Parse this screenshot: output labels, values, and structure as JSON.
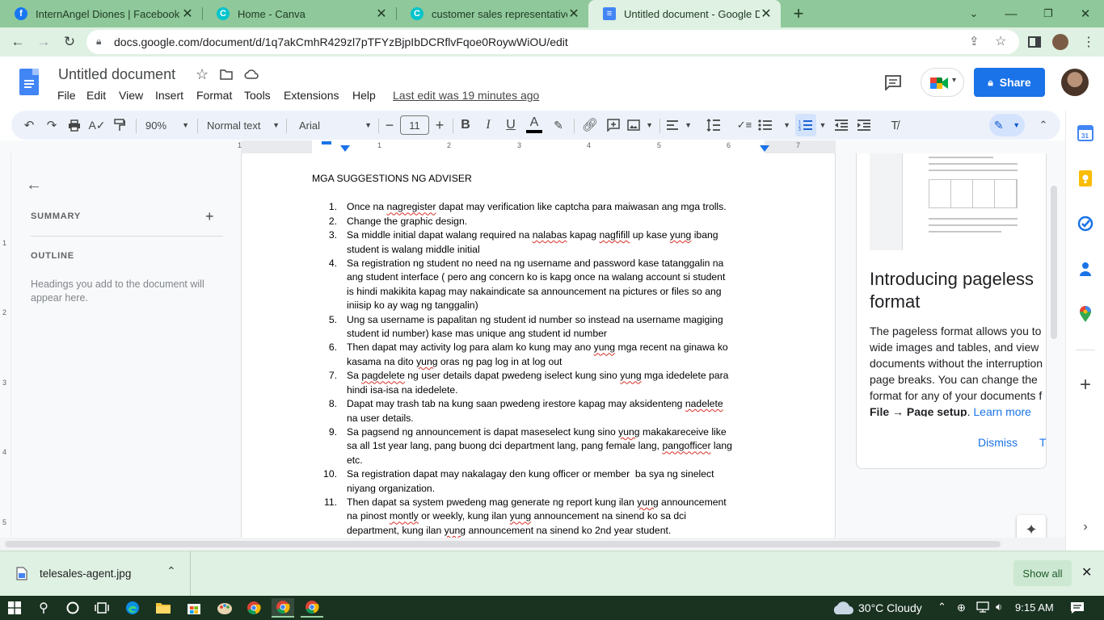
{
  "browser": {
    "tabs": [
      {
        "label": "InternAngel Diones | Facebook",
        "icon": "facebook-icon"
      },
      {
        "label": "Home - Canva",
        "icon": "canva-icon"
      },
      {
        "label": "customer sales representative - F",
        "icon": "canva-icon"
      },
      {
        "label": "Untitled document - Google Doc",
        "icon": "google-docs-icon"
      }
    ],
    "url": "docs.google.com/document/d/1q7akCmhR429zl7pTFYzBjpIbDCRflvFqoe0RoywWiOU/edit"
  },
  "docs": {
    "title": "Untitled document",
    "menu": [
      "File",
      "Edit",
      "View",
      "Insert",
      "Format",
      "Tools",
      "Extensions",
      "Help"
    ],
    "last_edit": "Last edit was 19 minutes ago",
    "share_label": "Share",
    "toolbar": {
      "zoom": "90%",
      "style": "Normal text",
      "font": "Arial",
      "font_size": "11"
    },
    "ruler_numbers": [
      "1",
      "1",
      "2",
      "3",
      "4",
      "5",
      "6",
      "7"
    ],
    "vruler_numbers": [
      "1",
      "2",
      "3",
      "4",
      "5"
    ]
  },
  "outline": {
    "summary_label": "SUMMARY",
    "outline_label": "OUTLINE",
    "hint": "Headings you add to the document will appear here."
  },
  "document": {
    "heading": "MGA SUGGESTIONS NG ADVISER",
    "items": [
      {
        "num": "1.",
        "lines": [
          "Once na nagregister dapat may verification like captcha para maiwasan ang mga trolls."
        ]
      },
      {
        "num": "2.",
        "lines": [
          "Change the graphic design."
        ]
      },
      {
        "num": "3.",
        "lines": [
          "Sa middle initial dapat walang required na nalabas kapag nagfifill up kase yung ibang",
          "student is walang middle initial"
        ]
      },
      {
        "num": "4.",
        "lines": [
          "Sa registration ng student no need na ng username and password kase tatanggalin na",
          "ang student interface ( pero ang concern ko is kapg once na walang account si student",
          "is hindi makikita kapag may nakaindicate sa announcement na pictures or files so ang",
          "iniisip ko ay wag ng tanggalin)"
        ]
      },
      {
        "num": "5.",
        "lines": [
          "Ung sa username is papalitan ng student id number so instead na username magiging",
          "student id number) kase mas unique ang student id number"
        ]
      },
      {
        "num": "6.",
        "lines": [
          "Then dapat may activity log para alam ko kung may ano yung mga recent na ginawa ko",
          "kasama na dito yung oras ng pag log in at log out"
        ]
      },
      {
        "num": "7.",
        "lines": [
          "Sa pagdelete ng user details dapat pwedeng iselect kung sino yung mga idedelete para",
          "hindi isa-isa na idedelete."
        ]
      },
      {
        "num": "8.",
        "lines": [
          "Dapat may trash tab na kung saan pwedeng irestore kapag may aksidenteng nadelete",
          "na user details."
        ]
      },
      {
        "num": "9.",
        "lines": [
          "Sa pagsend ng announcement is dapat maseselect kung sino yung makakareceive like",
          "sa all 1st year lang, pang buong dci department lang, pang female lang, pangofficer lang",
          "etc."
        ]
      },
      {
        "num": "10.",
        "lines": [
          "Sa registration dapat may nakalagay den kung officer or member  ba sya ng sinelect",
          "niyang organization."
        ]
      },
      {
        "num": "11.",
        "lines": [
          "Then dapat sa system pwedeng mag generate ng report kung ilan yung announcement",
          "na pinost montly or weekly, kung ilan yung announcement na sinend ko sa dci",
          "department, kung ilan yung announcement na sinend ko 2nd year student."
        ]
      }
    ],
    "misspelled": [
      "nagregister",
      "nalabas",
      "nagfifill",
      "pagdelete",
      "nadelete",
      "pangofficer",
      "yung",
      "montly"
    ]
  },
  "pageless": {
    "title": "Introducing pageless format",
    "body_lines": [
      "The pageless format allows you to",
      "wide images and tables, and view",
      "documents without the interruption",
      "page breaks. You can change the",
      "format for any of your documents f"
    ],
    "bold_text": "File → Page setup",
    "learn_more": "Learn more",
    "dismiss": "Dismiss",
    "try_partial": "T"
  },
  "download": {
    "filename": "telesales-agent.jpg",
    "show_all": "Show all"
  },
  "taskbar": {
    "weather": "30°C  Cloudy",
    "time": "9:15 AM"
  },
  "colors": {
    "chrome_frame": "#8fc89a",
    "chrome_toolbar": "#dff1e2",
    "docs_blue": "#1a73e8",
    "share_button": "#0b57d0",
    "toolbar_bg": "#edf2fa",
    "taskbar": "#1a3321"
  }
}
